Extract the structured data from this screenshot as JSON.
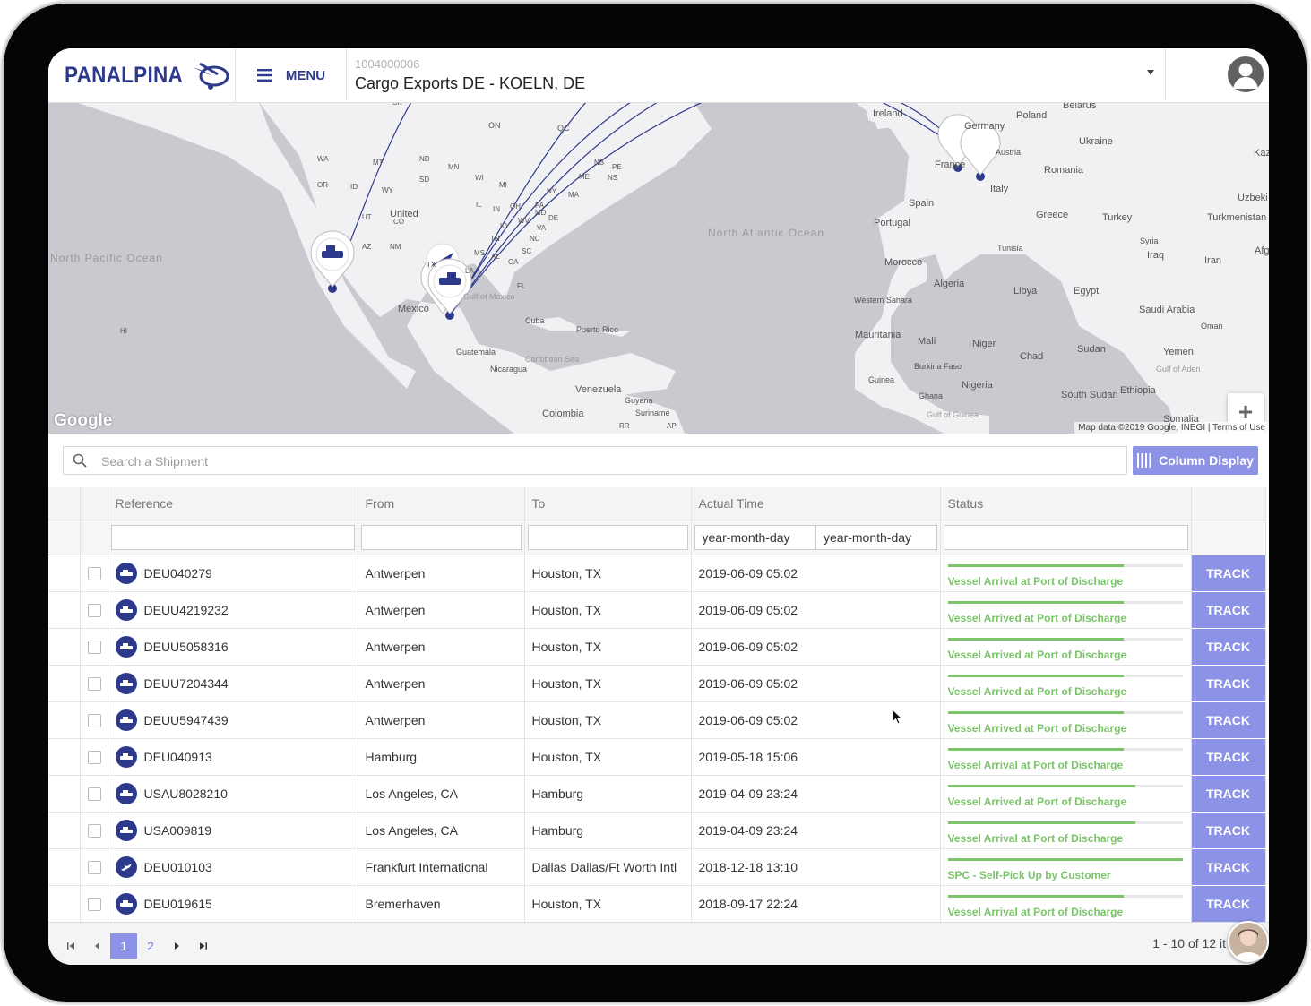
{
  "brand": {
    "name": "PANALPINA",
    "color": "#2d3a8c",
    "accent": "#8c93e6",
    "success": "#7cc36b"
  },
  "header": {
    "menu_label": "MENU",
    "account_id": "1004000006",
    "account_name": "Cargo Exports DE - KOELN, DE"
  },
  "map": {
    "attribution": "Map data ©2019 Google, INEGI",
    "terms": "Terms of Use",
    "google": "Google",
    "labels": {
      "ireland": "Ireland",
      "belarus": "Belarus",
      "poland": "Poland",
      "germany": "Germany",
      "ukraine": "Ukraine",
      "austria": "Austria",
      "france": "France",
      "romania": "Romania",
      "italy": "Italy",
      "spain": "Spain",
      "portugal": "Portugal",
      "greece": "Greece",
      "turkey": "Turkey",
      "syria": "Syria",
      "iraq": "Iraq",
      "iran": "Iran",
      "tunisia": "Tunisia",
      "morocco": "Morocco",
      "algeria": "Algeria",
      "libya": "Libya",
      "egypt": "Egypt",
      "saudi": "Saudi Arabia",
      "oman": "Oman",
      "yemen": "Yemen",
      "western_sahara": "Western Sahara",
      "mauritania": "Mauritania",
      "mali": "Mali",
      "niger": "Niger",
      "chad": "Chad",
      "sudan": "Sudan",
      "burkina": "Burkina Faso",
      "guinea": "Guinea",
      "ghana": "Ghana",
      "nigeria": "Nigeria",
      "south_sudan": "South Sudan",
      "ethiopia": "Ethiopia",
      "somalia": "Somalia",
      "gulf_guinea": "Gulf of Guinea",
      "gulf_aden": "Gulf of Aden",
      "uzbek": "Uzbeki",
      "turkmen": "Turkmenistan",
      "afgh": "Afgha",
      "kaz": "Kaz",
      "north_atlantic": "North Atlantic Ocean",
      "north_pacific": "North Pacific Ocean",
      "united": "United",
      "mexico": "Mexico",
      "gulf_mexico": "Gulf of Mexico",
      "cuba": "Cuba",
      "puerto_rico": "Puerto Rico",
      "guatemala": "Guatemala",
      "nicaragua": "Nicaragua",
      "caribbean": "Caribbean Sea",
      "venezuela": "Venezuela",
      "guyana": "Guyana",
      "suriname": "Suriname",
      "colombia": "Colombia",
      "wa": "WA",
      "or": "OR",
      "id": "ID",
      "mt": "MT",
      "wy": "WY",
      "ut": "UT",
      "co": "CO",
      "az": "AZ",
      "nm": "NM",
      "nd": "ND",
      "sd": "SD",
      "mn": "MN",
      "wi": "WI",
      "il": "IL",
      "in": "IN",
      "ky": "KY",
      "tn": "TN",
      "ms": "MS",
      "al": "AL",
      "ga": "GA",
      "sc": "SC",
      "nc": "NC",
      "va": "VA",
      "wv": "WV",
      "pa": "PA",
      "ny": "NY",
      "md": "MD",
      "de": "DE",
      "ma": "MA",
      "nb": "NB",
      "me": "ME",
      "ns": "NS",
      "pe": "PE",
      "on": "ON",
      "qc": "QC",
      "tx": "TX",
      "la": "LA",
      "fl": "FL",
      "hi": "HI",
      "rr": "RR",
      "ap": "AP",
      "sk": "SK",
      "mi": "MI",
      "oh": "OH"
    }
  },
  "search": {
    "placeholder": "Search a Shipment"
  },
  "column_display_label": "Column Display",
  "table": {
    "columns": {
      "reference": "Reference",
      "from": "From",
      "to": "To",
      "actual_time": "Actual Time",
      "status": "Status"
    },
    "date_placeholder": "year-month-day",
    "track_label": "TRACK",
    "rows": [
      {
        "mode": "ship",
        "ref": "DEU040279",
        "from": "Antwerpen",
        "to": "Houston, TX",
        "time": "2019-06-09 05:02",
        "status": "Vessel Arrival at Port of Discharge",
        "progress": 0.75
      },
      {
        "mode": "ship",
        "ref": "DEUU4219232",
        "from": "Antwerpen",
        "to": "Houston, TX",
        "time": "2019-06-09 05:02",
        "status": "Vessel Arrived at Port of Discharge",
        "progress": 0.75
      },
      {
        "mode": "ship",
        "ref": "DEUU5058316",
        "from": "Antwerpen",
        "to": "Houston, TX",
        "time": "2019-06-09 05:02",
        "status": "Vessel Arrived at Port of Discharge",
        "progress": 0.75
      },
      {
        "mode": "ship",
        "ref": "DEUU7204344",
        "from": "Antwerpen",
        "to": "Houston, TX",
        "time": "2019-06-09 05:02",
        "status": "Vessel Arrived at Port of Discharge",
        "progress": 0.75
      },
      {
        "mode": "ship",
        "ref": "DEUU5947439",
        "from": "Antwerpen",
        "to": "Houston, TX",
        "time": "2019-06-09 05:02",
        "status": "Vessel Arrived at Port of Discharge",
        "progress": 0.75
      },
      {
        "mode": "ship",
        "ref": "DEU040913",
        "from": "Hamburg",
        "to": "Houston, TX",
        "time": "2019-05-18 15:06",
        "status": "Vessel Arrival at Port of Discharge",
        "progress": 0.75
      },
      {
        "mode": "ship",
        "ref": "USAU8028210",
        "from": "Los Angeles, CA",
        "to": "Hamburg",
        "time": "2019-04-09 23:24",
        "status": "Vessel Arrived at Port of Discharge",
        "progress": 0.8
      },
      {
        "mode": "ship",
        "ref": "USA009819",
        "from": "Los Angeles, CA",
        "to": "Hamburg",
        "time": "2019-04-09 23:24",
        "status": "Vessel Arrival at Port of Discharge",
        "progress": 0.8
      },
      {
        "mode": "air",
        "ref": "DEU010103",
        "from": "Frankfurt International",
        "to": "Dallas Dallas/Ft Worth Intl",
        "time": "2018-12-18 13:10",
        "status": "SPC - Self-Pick Up by Customer",
        "progress": 1.0
      },
      {
        "mode": "ship",
        "ref": "DEU019615",
        "from": "Bremerhaven",
        "to": "Houston, TX",
        "time": "2018-09-17 22:24",
        "status": "Vessel Arrival at Port of Discharge",
        "progress": 0.75
      }
    ]
  },
  "pager": {
    "pages": [
      "1",
      "2"
    ],
    "current": "1",
    "info": "1 - 10 of 12 it"
  }
}
